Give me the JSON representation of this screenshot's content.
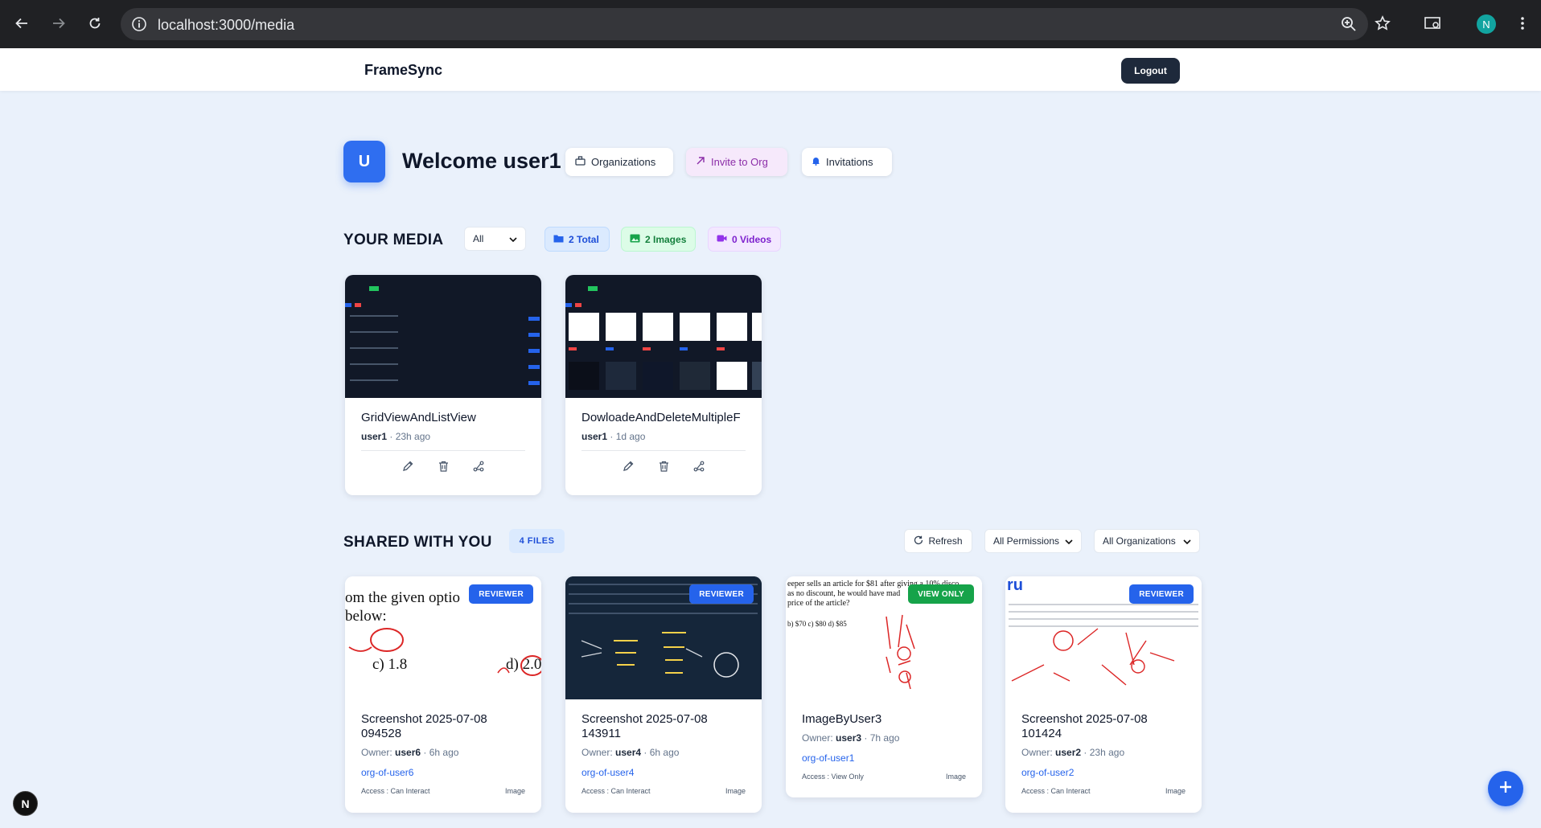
{
  "browser": {
    "url": "localhost:3000/media",
    "profile_initial": "N"
  },
  "header": {
    "brand": "FrameSync",
    "logout_label": "Logout"
  },
  "welcome": {
    "avatar_initial": "U",
    "title": "Welcome user1",
    "organizations_label": "Organizations",
    "invite_label": "Invite to Org",
    "invitations_label": "Invitations"
  },
  "your_media": {
    "title": "YOUR MEDIA",
    "filter_value": "All",
    "total_label": "2 Total",
    "images_label": "2 Images",
    "videos_label": "0 Videos",
    "items": [
      {
        "title": "GridViewAndListView",
        "owner": "user1",
        "time": "· 23h ago"
      },
      {
        "title": "DowloadeAndDeleteMultipleF",
        "owner": "user1",
        "time": "· 1d ago"
      }
    ]
  },
  "shared": {
    "title": "SHARED WITH YOU",
    "files_label": "4 FILES",
    "refresh_label": "Refresh",
    "permissions_filter": "All Permissions",
    "organizations_filter": "All Organizations",
    "items": [
      {
        "title_line1": "Screenshot 2025-07-08",
        "title_line2": "094528",
        "owner_label": "Owner:",
        "owner": "user6",
        "time": "· 6h ago",
        "org": "org-of-user6",
        "access": "Access : Can Interact",
        "type": "Image",
        "badge": "REVIEWER",
        "thumb_text_1": "om the given optio",
        "thumb_text_2": "below:",
        "thumb_text_3": "c) 1.8",
        "thumb_text_4": "d) 2.0"
      },
      {
        "title_line1": "Screenshot 2025-07-08",
        "title_line2": "143911",
        "owner_label": "Owner:",
        "owner": "user4",
        "time": "· 6h ago",
        "org": "org-of-user4",
        "access": "Access : Can Interact",
        "type": "Image",
        "badge": "REVIEWER"
      },
      {
        "title_line1": "ImageByUser3",
        "title_line2": "",
        "owner_label": "Owner:",
        "owner": "user3",
        "time": "· 7h ago",
        "org": "org-of-user1",
        "access": "Access : View Only",
        "type": "Image",
        "badge": "VIEW ONLY",
        "thumb_text_1": "eeper sells an article for $81 after giving a 10% disco",
        "thumb_text_2": "as no discount, he would have mad",
        "thumb_text_3": "price of the article?",
        "thumb_text_4": "b) $70   c) $80   d) $85"
      },
      {
        "title_line1": "Screenshot 2025-07-08",
        "title_line2": "101424",
        "owner_label": "Owner:",
        "owner": "user2",
        "time": "· 23h ago",
        "org": "org-of-user2",
        "access": "Access : Can Interact",
        "type": "Image",
        "badge": "REVIEWER",
        "thumb_text_1": "ru"
      }
    ]
  },
  "colors": {
    "accent": "#2563eb",
    "page_bg": "#eaf1fb",
    "reviewer_badge": "#2563eb",
    "view_only_badge": "#16a34a"
  },
  "icons": [
    "back-arrow-icon",
    "forward-arrow-icon",
    "reload-icon",
    "site-info-icon",
    "zoom-icon",
    "bookmark-star-icon",
    "cast-icon",
    "menu-dots-icon",
    "organizations-icon",
    "invite-icon",
    "bell-icon",
    "folder-icon",
    "image-icon",
    "video-icon",
    "edit-icon",
    "trash-icon",
    "share-icon",
    "refresh-icon",
    "plus-icon"
  ]
}
